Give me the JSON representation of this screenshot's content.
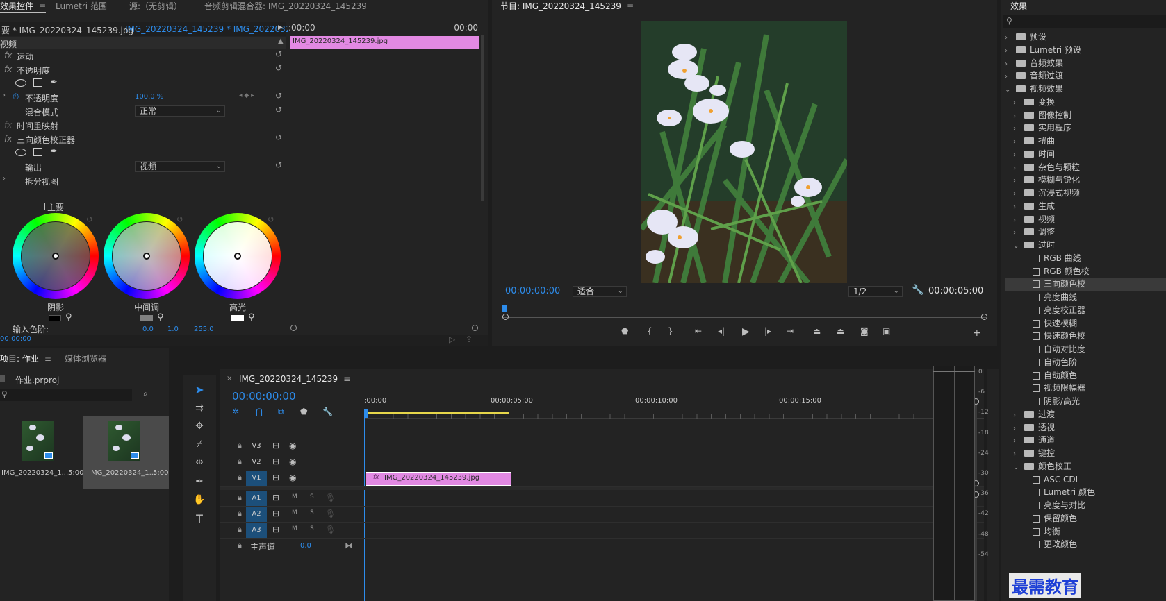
{
  "colors": {
    "accent": "#2d8ceb",
    "clip": "#e289e3",
    "panel": "#232323",
    "selected": "#1c4f7a"
  },
  "effect_controls": {
    "tabs": [
      "效果控件",
      "Lumetri 范围",
      "源:（无剪辑）",
      "音频剪辑混合器: IMG_20220324_145239"
    ],
    "source_label": "要 * IMG_20220324_145239.jpg",
    "sequence_label": "IMG_20220324_145239 * IMG_20220324_...",
    "section": "视频",
    "timeline_start": ":00:00",
    "timeline_end": "00:00",
    "clip_label": "IMG_20220324_145239.jpg",
    "rows": {
      "motion": "运动",
      "opacity_group": "不透明度",
      "opacity": "不透明度",
      "opacity_value": "100.0 %",
      "blend_mode": "混合模式",
      "blend_value": "正常",
      "time_remap": "时间重映射",
      "three_way": "三向颜色校正器",
      "output": "输出",
      "output_value": "视频",
      "split_view": "拆分视图",
      "master": "主要"
    },
    "wheels": [
      "阴影",
      "中间调",
      "高光"
    ],
    "input_levels_label": "输入色阶:",
    "input_levels": [
      "0.0",
      "1.0",
      "255.0"
    ],
    "timecode": "00:00:00"
  },
  "program": {
    "title": "节目: IMG_20220324_145239",
    "timecode": "00:00:00:00",
    "fit": "适合",
    "resolution": "1/2",
    "duration": "00:00:05:00"
  },
  "effects": {
    "title": "效果",
    "search_placeholder": "",
    "items": [
      {
        "label": "预设",
        "level": 0,
        "kind": "folder",
        "expanded": false
      },
      {
        "label": "Lumetri 预设",
        "level": 0,
        "kind": "folder",
        "expanded": false
      },
      {
        "label": "音频效果",
        "level": 0,
        "kind": "folder",
        "expanded": false
      },
      {
        "label": "音频过渡",
        "level": 0,
        "kind": "folder",
        "expanded": false
      },
      {
        "label": "视频效果",
        "level": 0,
        "kind": "folder",
        "expanded": true
      },
      {
        "label": "变换",
        "level": 1,
        "kind": "folder",
        "expanded": false
      },
      {
        "label": "图像控制",
        "level": 1,
        "kind": "folder",
        "expanded": false
      },
      {
        "label": "实用程序",
        "level": 1,
        "kind": "folder",
        "expanded": false
      },
      {
        "label": "扭曲",
        "level": 1,
        "kind": "folder",
        "expanded": false
      },
      {
        "label": "时间",
        "level": 1,
        "kind": "folder",
        "expanded": false
      },
      {
        "label": "杂色与颗粒",
        "level": 1,
        "kind": "folder",
        "expanded": false
      },
      {
        "label": "模糊与锐化",
        "level": 1,
        "kind": "folder",
        "expanded": false
      },
      {
        "label": "沉浸式视频",
        "level": 1,
        "kind": "folder",
        "expanded": false
      },
      {
        "label": "生成",
        "level": 1,
        "kind": "folder",
        "expanded": false
      },
      {
        "label": "视频",
        "level": 1,
        "kind": "folder",
        "expanded": false
      },
      {
        "label": "调整",
        "level": 1,
        "kind": "folder",
        "expanded": false
      },
      {
        "label": "过时",
        "level": 1,
        "kind": "folder",
        "expanded": true
      },
      {
        "label": "RGB 曲线",
        "level": 2,
        "kind": "file"
      },
      {
        "label": "RGB 颜色校",
        "level": 2,
        "kind": "file"
      },
      {
        "label": "三向颜色校",
        "level": 2,
        "kind": "file",
        "selected": true
      },
      {
        "label": "亮度曲线",
        "level": 2,
        "kind": "file"
      },
      {
        "label": "亮度校正器",
        "level": 2,
        "kind": "file"
      },
      {
        "label": "快速模糊",
        "level": 2,
        "kind": "file"
      },
      {
        "label": "快速颜色校",
        "level": 2,
        "kind": "file"
      },
      {
        "label": "自动对比度",
        "level": 2,
        "kind": "file"
      },
      {
        "label": "自动色阶",
        "level": 2,
        "kind": "file"
      },
      {
        "label": "自动颜色",
        "level": 2,
        "kind": "file"
      },
      {
        "label": "视频限幅器",
        "level": 2,
        "kind": "file"
      },
      {
        "label": "阴影/高光",
        "level": 2,
        "kind": "file"
      },
      {
        "label": "过渡",
        "level": 1,
        "kind": "folder",
        "expanded": false
      },
      {
        "label": "透视",
        "level": 1,
        "kind": "folder",
        "expanded": false
      },
      {
        "label": "通道",
        "level": 1,
        "kind": "folder",
        "expanded": false
      },
      {
        "label": "键控",
        "level": 1,
        "kind": "folder",
        "expanded": false
      },
      {
        "label": "颜色校正",
        "level": 1,
        "kind": "folder",
        "expanded": true
      },
      {
        "label": "ASC CDL",
        "level": 2,
        "kind": "file"
      },
      {
        "label": "Lumetri 颜色",
        "level": 2,
        "kind": "file"
      },
      {
        "label": "亮度与对比",
        "level": 2,
        "kind": "file"
      },
      {
        "label": "保留颜色",
        "level": 2,
        "kind": "file"
      },
      {
        "label": "均衡",
        "level": 2,
        "kind": "file"
      },
      {
        "label": "更改颜色",
        "level": 2,
        "kind": "file"
      }
    ]
  },
  "project": {
    "tabs": [
      "项目: 作业",
      "媒体浏览器"
    ],
    "project_file": "作业.prproj",
    "items": [
      {
        "name": "IMG_20220324_1...",
        "duration": "5:00"
      },
      {
        "name": "IMG_20220324_1...",
        "duration": "5:00"
      }
    ]
  },
  "timeline": {
    "tab": "IMG_20220324_145239",
    "timecode": "00:00:00:00",
    "ruler": [
      ":00:00",
      "00:00:05:00",
      "00:00:10:00",
      "00:00:15:00"
    ],
    "tracks": {
      "video": [
        "V3",
        "V2",
        "V1"
      ],
      "audio": [
        "A1",
        "A2",
        "A3"
      ],
      "master": "主声道",
      "master_value": "0.0"
    },
    "clip_label": "IMG_20220324_145239.jpg"
  },
  "meter": {
    "ticks": [
      "0",
      "-6",
      "-12",
      "-18",
      "-24",
      "-30",
      "-36",
      "-42",
      "-48",
      "-54"
    ]
  },
  "watermark": "最需教育"
}
